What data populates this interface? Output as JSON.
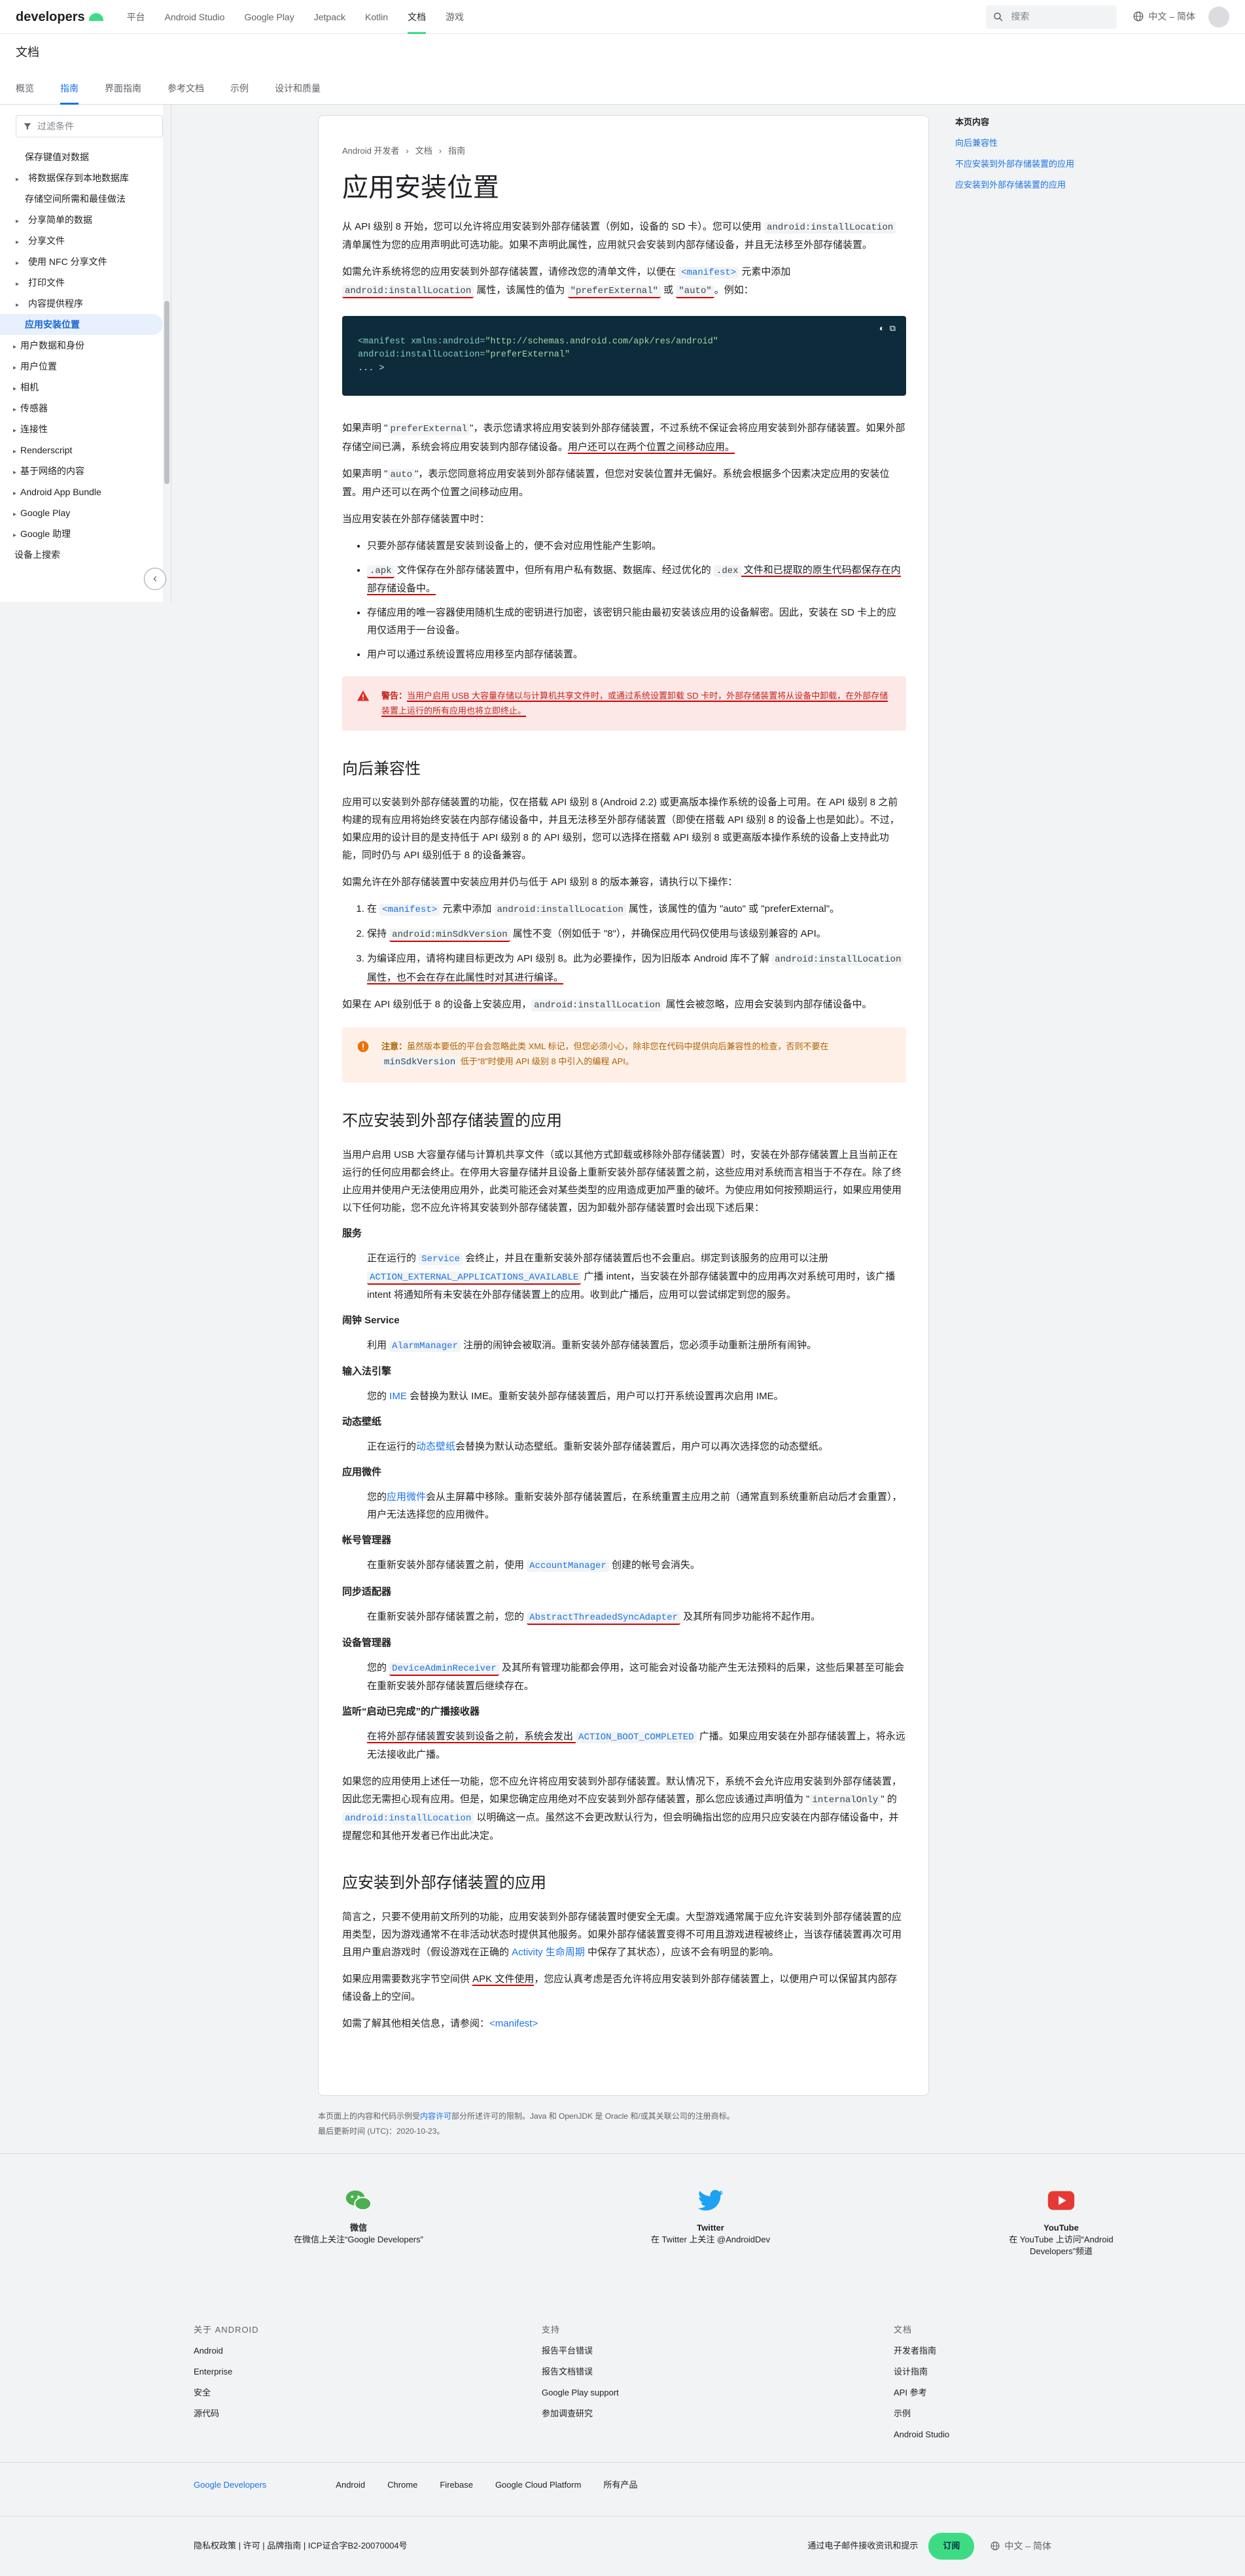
{
  "header": {
    "logo": "developers",
    "nav": [
      "平台",
      "Android Studio",
      "Google Play",
      "Jetpack",
      "Kotlin",
      "文档",
      "游戏"
    ],
    "active_nav": "文档",
    "search_placeholder": "搜索",
    "language": "中文 – 简体"
  },
  "subheader": {
    "title": "文档",
    "tabs": [
      "概览",
      "指南",
      "界面指南",
      "参考文档",
      "示例",
      "设计和质量"
    ],
    "active_tab": "指南"
  },
  "leftnav": {
    "filter_placeholder": "过滤条件",
    "items": [
      {
        "label": "保存键值对数据",
        "level": 1,
        "caret": false
      },
      {
        "label": "将数据保存到本地数据库",
        "level": 1,
        "caret": true
      },
      {
        "label": "存储空间所需和最佳做法",
        "level": 1,
        "caret": false
      },
      {
        "label": "分享简单的数据",
        "level": 1,
        "caret": true
      },
      {
        "label": "分享文件",
        "level": 1,
        "caret": true
      },
      {
        "label": "使用 NFC 分享文件",
        "level": 1,
        "caret": true
      },
      {
        "label": "打印文件",
        "level": 1,
        "caret": true
      },
      {
        "label": "内容提供程序",
        "level": 1,
        "caret": true
      },
      {
        "label": "应用安装位置",
        "level": 1,
        "caret": false,
        "active": true
      },
      {
        "label": "用户数据和身份",
        "level": 0,
        "caret": true
      },
      {
        "label": "用户位置",
        "level": 0,
        "caret": true
      },
      {
        "label": "相机",
        "level": 0,
        "caret": true
      },
      {
        "label": "传感器",
        "level": 0,
        "caret": true
      },
      {
        "label": "连接性",
        "level": 0,
        "caret": true
      },
      {
        "label": "Renderscript",
        "level": 0,
        "caret": true
      },
      {
        "label": "基于网络的内容",
        "level": 0,
        "caret": true
      },
      {
        "label": "Android App Bundle",
        "level": 0,
        "caret": true
      },
      {
        "label": "Google Play",
        "level": 0,
        "caret": true
      },
      {
        "label": "Google 助理",
        "level": 0,
        "caret": true
      },
      {
        "label": "设备上搜索",
        "level": 0,
        "caret": false
      }
    ],
    "collapse_icon": "‹"
  },
  "article": {
    "breadcrumb": [
      "Android 开发者",
      "文档",
      "指南"
    ],
    "title": "应用安装位置",
    "p1_a": "从 API 级别 8 开始，您可以允许将应用安装到外部存储装置（例如，设备的 SD 卡）。您可以使用 ",
    "p1_code": "android:installLocation",
    "p1_b": " 清单属性为您的应用声明此可选功能。如果不声明此属性，应用就只会安装到内部存储设备，并且无法移至外部存储装置。",
    "p2_a": "如需允许系统将您的应用安装到外部存储装置，请修改您的清单文件，以便在 ",
    "p2_code1": "<manifest>",
    "p2_b": " 元素中添加 ",
    "p2_code2": "android:installLocation",
    "p2_c": " 属性，该属性的值为 ",
    "p2_code3": "\"preferExternal\"",
    "p2_d": " 或 ",
    "p2_code4": "\"auto\"",
    "p2_e": "。例如：",
    "code_line1_a": "<manifest xmlns:android=",
    "code_line1_b": "\"http://schemas.android.com/apk/res/android\"",
    "code_line2_a": "    android:installLocation=",
    "code_line2_b": "\"preferExternal\"",
    "code_line3": "    ... >",
    "p3_a": "如果声明 \"",
    "p3_code": "preferExternal",
    "p3_b": "\"，表示您请求将应用安装到外部存储装置，不过系统不保证会将应用安装到外部存储装置。如果外部存储空间已满，系统会将应用安装到内部存储设备。",
    "p3_c": "用户还可以在两个位置之间移动应用。",
    "p4_a": "如果声明 \"",
    "p4_code": "auto",
    "p4_b": "\"，表示您同意将应用安装到外部存储装置，但您对安装位置并无偏好。系统会根据多个因素决定应用的安装位置。用户还可以在两个位置之间移动应用。",
    "p5": "当应用安装在外部存储装置中时：",
    "li1": "只要外部存储装置是安装到设备上的，便不会对应用性能产生影响。",
    "li2_a": "",
    "li2_code1": ".apk",
    "li2_b": " 文件保存在外部存储装置中，但所有用户私有数据、数据库、经过优化的 ",
    "li2_code2": ".dex",
    "li2_c": " 文件和已提取的原生代码都保存在内部存储设备中。",
    "li3": "存储应用的唯一容器使用随机生成的密钥进行加密，该密钥只能由最初安装该应用的设备解密。因此，安装在 SD 卡上的应用仅适用于一台设备。",
    "li4": "用户可以通过系统设置将应用移至内部存储装置。",
    "warn_label": "警告：",
    "warn_text": "当用户启用 USB 大容量存储以与计算机共享文件时，或通过系统设置卸载 SD 卡时，外部存储装置将从设备中卸载，在外部存储装置上运行的所有应用也将立即终止。",
    "h2_back": "向后兼容性",
    "bc_p1": "应用可以安装到外部存储装置的功能，仅在搭载 API 级别 8 (Android 2.2) 或更高版本操作系统的设备上可用。在 API 级别 8 之前构建的现有应用将始终安装在内部存储设备中，并且无法移至外部存储装置（即使在搭载 API 级别 8 的设备上也是如此）。不过，如果应用的设计目的是支持低于 API 级别 8 的 API 级别，您可以选择在搭载 API 级别 8 或更高版本操作系统的设备上支持此功能，同时仍与 API 级别低于 8 的设备兼容。",
    "bc_p2": "如需允许在外部存储装置中安装应用并仍与低于 API 级别 8 的版本兼容，请执行以下操作：",
    "bc_ol1_a": "在 ",
    "bc_ol1_code1": "<manifest>",
    "bc_ol1_b": " 元素中添加 ",
    "bc_ol1_code2": "android:installLocation",
    "bc_ol1_c": " 属性，该属性的值为 \"auto\" 或 \"preferExternal\"。",
    "bc_ol2_a": "保持 ",
    "bc_ol2_code": "android:minSdkVersion",
    "bc_ol2_b": " 属性不变（例如低于 \"8\"），并确保应用代码仅使用与该级别兼容的 API。",
    "bc_ol3_a": "为编译应用，请将构建目标更改为 API 级别 8。此为必要操作，因为旧版本 Android 库不了解 ",
    "bc_ol3_code": "android:installLocation",
    "bc_ol3_b": " 属性，也不会在存在此属性时对其进行编译。",
    "bc_p3_a": "如果在 API 级别低于 8 的设备上安装应用，",
    "bc_p3_code": "android:installLocation",
    "bc_p3_b": " 属性会被忽略，应用会安装到内部存储设备中。",
    "note_label": "注意：",
    "note_text_a": "虽然版本要低的平台会忽略此类 XML 标记，但您必须小心，除非您在代码中提供向后兼容性的检查，否则不要在 ",
    "note_code": "minSdkVersion",
    "note_text_b": " 低于“8”时使用 API 级别 8 中引入的编程 API。",
    "h2_not": "不应安装到外部存储装置的应用",
    "not_p1": "当用户启用 USB 大容量存储与计算机共享文件（或以其他方式卸载或移除外部存储装置）时，安装在外部存储装置上且当前正在运行的任何应用都会终止。在停用大容量存储并且设备上重新安装外部存储装置之前，这些应用对系统而言相当于不存在。除了终止应用并使用户无法使用应用外，此类可能还会对某些类型的应用造成更加严重的破坏。为使应用如何按预期运行，如果应用使用以下任何功能，您不应允许将其安装到外部存储装置，因为卸载外部存储装置时会出现下述后果：",
    "svc_h": "服务",
    "svc_a": "正在运行的 ",
    "svc_code": "Service",
    "svc_b": " 会终止，并且在重新安装外部存储装置后也不会重启。绑定到该服务的应用可以注册 ",
    "svc_code2": "ACTION_EXTERNAL_APPLICATIONS_AVAILABLE",
    "svc_c": " 广播 intent，当安装在外部存储装置中的应用再次对系统可用时，该广播 intent 将通知所有未安装在外部存储装置上的应用。收到此广播后，应用可以尝试绑定到您的服务。",
    "alarm_h": "闹钟 Service",
    "alarm_a": "利用 ",
    "alarm_code": "AlarmManager",
    "alarm_b": " 注册的闹钟会被取消。重新安装外部存储装置后，您必须手动重新注册所有闹钟。",
    "ime_h": "输入法引擎",
    "ime_a": "您的 ",
    "ime_link": "IME",
    "ime_b": " 会替换为默认 IME。重新安装外部存储装置后，用户可以打开系统设置再次启用 IME。",
    "wp_h": "动态壁纸",
    "wp_a": "正在运行的",
    "wp_link": "动态壁纸",
    "wp_b": "会替换为默认动态壁纸。重新安装外部存储装置后，用户可以再次选择您的动态壁纸。",
    "widget_h": "应用微件",
    "widget_a": "您的",
    "widget_link": "应用微件",
    "widget_b": "会从主屏幕中移除。重新安装外部存储装置后，在系统重置主应用之前（通常直到系统重新启动后才会重置），用户无法选择您的应用微件。",
    "acct_h": "帐号管理器",
    "acct_a": "在重新安装外部存储装置之前，使用 ",
    "acct_code": "AccountManager",
    "acct_b": " 创建的帐号会消失。",
    "sync_h": "同步适配器",
    "sync_a": "在重新安装外部存储装置之前，您的 ",
    "sync_code": "AbstractThreadedSyncAdapter",
    "sync_b": " 及其所有同步功能将不起作用。",
    "admin_h": "设备管理器",
    "admin_a": "您的 ",
    "admin_code": "DeviceAdminReceiver",
    "admin_b": " 及其所有管理功能都会停用，这可能会对设备功能产生无法预料的后果，这些后果甚至可能会在重新安装外部存储装置后继续存在。",
    "boot_h": "监听“启动已完成”的广播接收器",
    "boot_a": "在将外部存储装置安装到设备之前，系统会发出 ",
    "boot_code": "ACTION_BOOT_COMPLETED",
    "boot_b": " 广播。如果应用安装在外部存储装置上，将永远无法接收此广播。",
    "not_p2_a": "如果您的应用使用上述任一功能，您不应允许将应用安装到外部存储装置。默认情况下，系统不会允许应用安装到外部存储装置，因此您无需担心现有应用。但是，如果您确定应用绝对不应安装到外部存储装置，那么您应该通过声明值为 \"",
    "not_p2_code1": "internalOnly",
    "not_p2_b": "\" 的 ",
    "not_p2_code2": "android:installLocation",
    "not_p2_c": " 以明确这一点。虽然这不会更改默认行为，但会明确指出您的应用只应安装在内部存储设备中，并提醒您和其他开发者已作出此决定。",
    "h2_should": "应安装到外部存储装置的应用",
    "should_p1_a": "简言之，只要不使用前文所列的功能，应用安装到外部存储装置时便安全无虞。大型游戏通常属于应允许安装到外部存储装置的应用类型，因为游戏通常不在非活动状态时提供其他服务。如果外部存储装置变得不可用且游戏进程被终止，当该存储装置再次可用且用户重启游戏时（假设游戏在正确的 ",
    "should_p1_link": "Activity 生命周期",
    "should_p1_b": " 中保存了其状态），应该不会有明显的影响。",
    "should_p2_a": "如果应用需要数兆字节空间供 ",
    "should_p2_b": "APK 文件使用",
    "should_p2_c": "，您应认真考虑是否允许将应用安装到外部存储装置上，以便用户可以保留其内部存储设备上的空间。",
    "should_p3_a": "如需了解其他相关信息，请参阅：",
    "should_p3_link": "<manifest>"
  },
  "toc": {
    "head": "本页内容",
    "items": [
      "向后兼容性",
      "不应安装到外部存储装置的应用",
      "应安装到外部存储装置的应用"
    ]
  },
  "after_article": {
    "license_a": "本页面上的内容和代码示例受",
    "license_link": "内容许可",
    "license_b": "部分所述许可的限制。Java 和 OpenJDK 是 Oracle 和/或其关联公司的注册商标。",
    "updated": "最后更新时间 (UTC)：2020-10-23。"
  },
  "social": [
    {
      "name": "微信",
      "desc": "在微信上关注“Google Developers”",
      "color": "#4caf50"
    },
    {
      "name": "Twitter",
      "desc": "在 Twitter 上关注 @AndroidDev",
      "color": "#1da1f2"
    },
    {
      "name": "YouTube",
      "desc": "在 YouTube 上访问“Android Developers”频道",
      "color": "#e53935"
    }
  ],
  "footer_links": [
    {
      "head": "关于 ANDROID",
      "links": [
        "Android",
        "Enterprise",
        "安全",
        "源代码"
      ]
    },
    {
      "head": "支持",
      "links": [
        "报告平台错误",
        "报告文档错误",
        "Google Play support",
        "参加调查研究"
      ]
    },
    {
      "head": "文档",
      "links": [
        "开发者指南",
        "设计指南",
        "API 参考",
        "示例",
        "Android Studio"
      ]
    }
  ],
  "products": {
    "brand": "Google Developers",
    "items": [
      "Android",
      "Chrome",
      "Firebase",
      "Google Cloud Platform",
      "所有产品"
    ]
  },
  "bottom": {
    "legal": "隐私权政策 | 许可 | 品牌指南 | ICP证合字B2-20070004号",
    "subscribe_text": "通过电子邮件接收资讯和提示",
    "subscribe_button": "订阅",
    "language": "中文 – 简体"
  }
}
